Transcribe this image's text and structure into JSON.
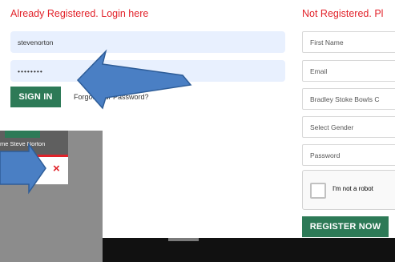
{
  "login": {
    "heading": "Already Registered. Login here",
    "username_value": "stevenorton",
    "password_value": "••••••••",
    "signin_label": "SIGN IN",
    "forgot_label": "Forgot Your Password?"
  },
  "register": {
    "heading": "Not Registered. Pl",
    "first_name_placeholder": "First Name",
    "email_placeholder": "Email",
    "club_value": "Bradley Stoke Bowls C",
    "gender_placeholder": "Select Gender",
    "password_placeholder": "Password",
    "captcha_label": "I'm not a robot",
    "register_label": "REGISTER NOW"
  },
  "background_popup": {
    "welcome_text": "me Steve Norton",
    "close_symbol": "×"
  },
  "colors": {
    "heading_red": "#e2222a",
    "button_green": "#2d7a57",
    "login_field_bg": "#e8f0fe",
    "arrow_blue": "#4a7fc4"
  }
}
